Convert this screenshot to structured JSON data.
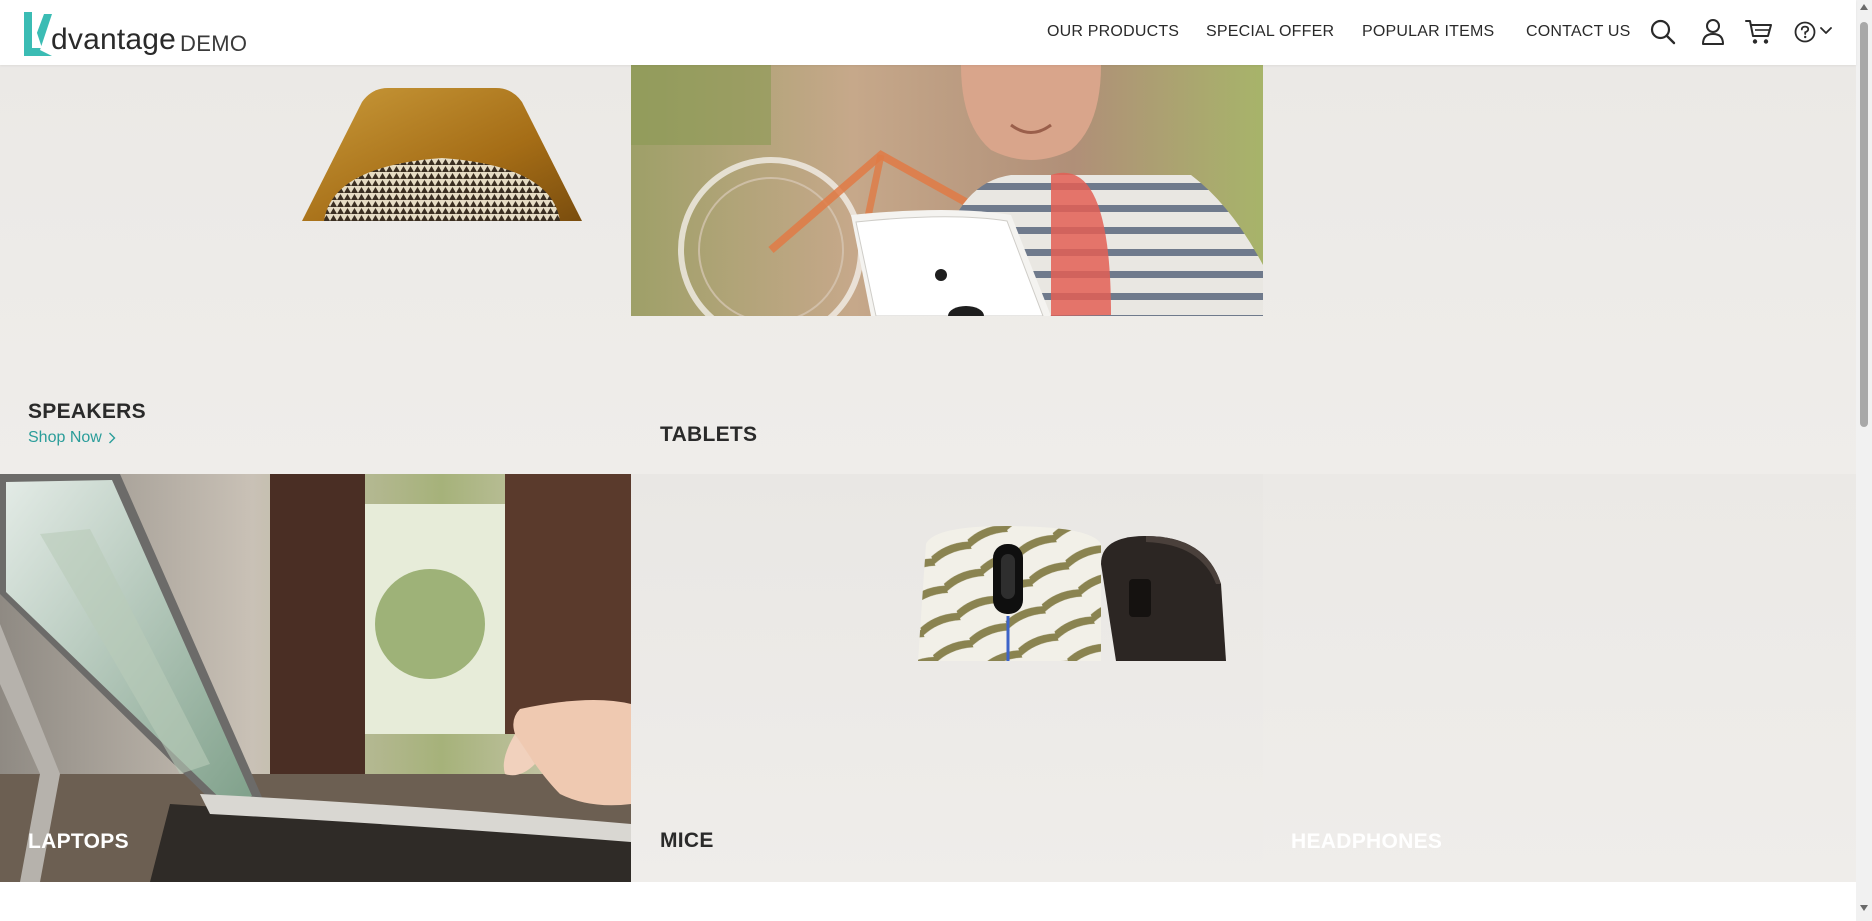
{
  "header": {
    "logo_text": "dvantage",
    "logo_sub": "DEMO",
    "nav": [
      {
        "label": "OUR PRODUCTS"
      },
      {
        "label": "SPECIAL OFFER"
      },
      {
        "label": "POPULAR ITEMS"
      },
      {
        "label": "CONTACT US"
      }
    ],
    "icons": [
      "search-icon",
      "user-icon",
      "cart-icon",
      "help-icon",
      "chevron-down-icon"
    ]
  },
  "categories": [
    {
      "name": "SPEAKERS",
      "link": "Shop Now"
    },
    {
      "name": "TABLETS"
    },
    {
      "name": "LAPTOPS"
    },
    {
      "name": "MICE"
    },
    {
      "name": "HEADPHONES"
    }
  ],
  "colors": {
    "accent": "#2a9d9a",
    "tile_background": "#ebe9e5",
    "text": "#2a2a2a"
  }
}
